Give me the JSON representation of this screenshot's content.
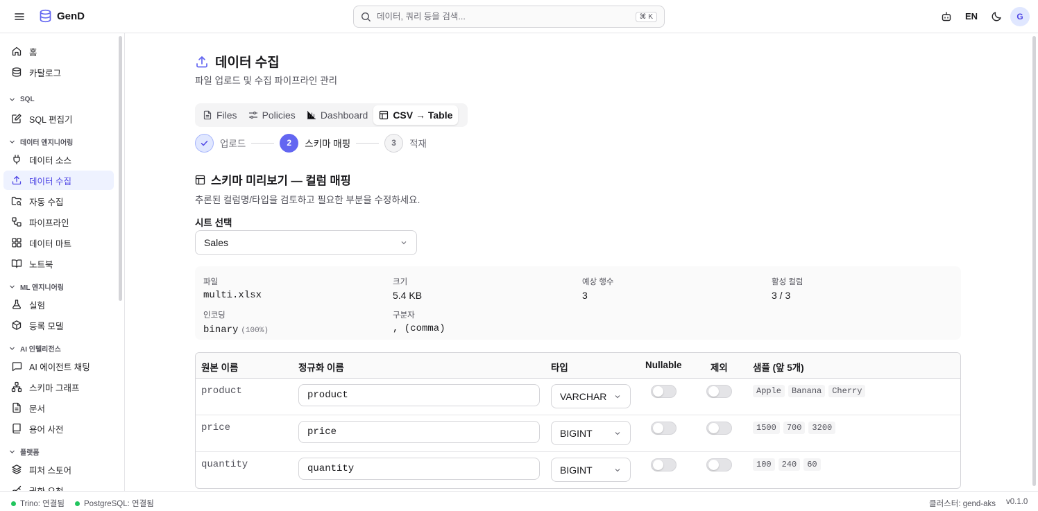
{
  "app": {
    "name": "GenD"
  },
  "search": {
    "placeholder": "데이터, 쿼리 등을 검색...",
    "shortcut": "⌘ K"
  },
  "header": {
    "lang": "EN",
    "avatar_initial": "G"
  },
  "sidebar": {
    "items": [
      {
        "label": "홈",
        "icon": "home-icon"
      },
      {
        "label": "카탈로그",
        "icon": "database-icon"
      }
    ],
    "groups": [
      {
        "label": "SQL",
        "items": [
          {
            "label": "SQL 편집기",
            "icon": "edit-icon"
          }
        ]
      },
      {
        "label": "데이터 엔지니어링",
        "items": [
          {
            "label": "데이터 소스",
            "icon": "plug-icon"
          },
          {
            "label": "데이터 수집",
            "icon": "upload-icon",
            "active": true
          },
          {
            "label": "자동 수집",
            "icon": "folder-search-icon"
          },
          {
            "label": "파이프라인",
            "icon": "workflow-icon"
          },
          {
            "label": "데이터 마트",
            "icon": "grid-icon"
          },
          {
            "label": "노트북",
            "icon": "book-open-icon"
          }
        ]
      },
      {
        "label": "ML 엔지니어링",
        "items": [
          {
            "label": "실험",
            "icon": "flask-icon"
          },
          {
            "label": "등록 모델",
            "icon": "box-icon"
          }
        ]
      },
      {
        "label": "AI 인텔리전스",
        "items": [
          {
            "label": "AI 에이전트 채팅",
            "icon": "chat-icon"
          },
          {
            "label": "스키마 그래프",
            "icon": "network-icon"
          },
          {
            "label": "문서",
            "icon": "document-icon"
          },
          {
            "label": "용어 사전",
            "icon": "dictionary-icon"
          }
        ]
      },
      {
        "label": "플랫폼",
        "items": [
          {
            "label": "피처 스토어",
            "icon": "layers-icon"
          },
          {
            "label": "권한 요청",
            "icon": "key-icon"
          }
        ]
      }
    ]
  },
  "page": {
    "title": "데이터 수집",
    "subtitle": "파일 업로드 및 수집 파이프라인 관리"
  },
  "tabs": [
    {
      "label": "Files",
      "icon": "file-icon"
    },
    {
      "label": "Policies",
      "icon": "sliders-icon"
    },
    {
      "label": "Dashboard",
      "icon": "bar-chart-icon"
    },
    {
      "label": "CSV → Table",
      "icon": "table-icon",
      "active": true
    }
  ],
  "stepper": [
    {
      "number": "1",
      "label": "업로드",
      "state": "done"
    },
    {
      "number": "2",
      "label": "스키마 매핑",
      "state": "current"
    },
    {
      "number": "3",
      "label": "적재",
      "state": "todo"
    }
  ],
  "schema": {
    "title": "스키마 미리보기 — 컬럼 매핑",
    "subtitle": "추론된 컬럼명/타입을 검토하고 필요한 부분을 수정하세요.",
    "sheet_label": "시트 선택",
    "sheet_value": "Sales"
  },
  "file_info": {
    "file": {
      "label": "파일",
      "value": "multi.xlsx"
    },
    "size": {
      "label": "크기",
      "value": "5.4 KB"
    },
    "rows": {
      "label": "예상 행수",
      "value": "3"
    },
    "active_cols": {
      "label": "활성 컬럼",
      "value": "3 / 3"
    },
    "encoding": {
      "label": "인코딩",
      "value": "binary",
      "confidence": "(100%)"
    },
    "delimiter": {
      "label": "구분자",
      "value": ", (comma)"
    }
  },
  "table": {
    "headers": [
      "원본 이름",
      "정규화 이름",
      "타입",
      "Nullable",
      "제외",
      "샘플 (앞 5개)"
    ],
    "rows": [
      {
        "original": "product",
        "normalized": "product",
        "type": "VARCHAR",
        "nullable": false,
        "exclude": false,
        "samples": [
          "Apple",
          "Banana",
          "Cherry"
        ]
      },
      {
        "original": "price",
        "normalized": "price",
        "type": "BIGINT",
        "nullable": false,
        "exclude": false,
        "samples": [
          "1500",
          "700",
          "3200"
        ]
      },
      {
        "original": "quantity",
        "normalized": "quantity",
        "type": "BIGINT",
        "nullable": false,
        "exclude": false,
        "samples": [
          "100",
          "240",
          "60"
        ]
      }
    ]
  },
  "status": {
    "trino": "Trino: 연결됨",
    "postgres": "PostgreSQL: 연결됨",
    "cluster": "클러스터: gend-aks",
    "version": "v0.1.0"
  },
  "colors": {
    "accent": "#6366f1",
    "accent_bg": "#eef2ff",
    "connected": "#22c55e"
  }
}
